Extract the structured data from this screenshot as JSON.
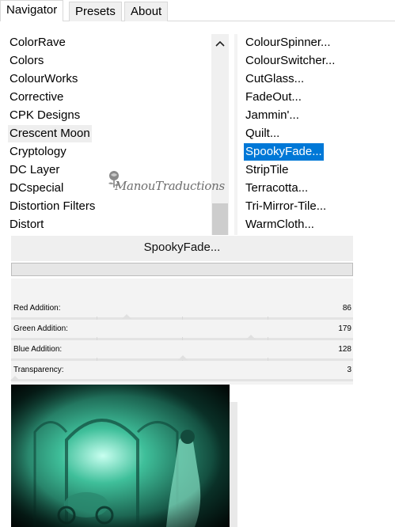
{
  "tabs": [
    {
      "label": "Navigator",
      "active": true
    },
    {
      "label": "Presets",
      "active": false
    },
    {
      "label": "About",
      "active": false
    }
  ],
  "categories": {
    "items": [
      "ColorRave",
      "Colors",
      "ColourWorks",
      "Corrective",
      "CPK Designs",
      "Crescent Moon",
      "Cryptology",
      "DC Layer",
      "DCspecial",
      "Distortion Filters",
      "Distort"
    ],
    "highlighted": "Crescent Moon"
  },
  "filters": {
    "items": [
      "ColourSpinner...",
      "ColourSwitcher...",
      "CutGlass...",
      "FadeOut...",
      "Jammin'...",
      "Quilt...",
      "SpookyFade...",
      "StripTile",
      "Terracotta...",
      "Tri-Mirror-Tile...",
      "WarmCloth..."
    ],
    "selected": "SpookyFade..."
  },
  "filter_title": "SpookyFade...",
  "sliders": [
    {
      "label": "Red Addition:",
      "value": "86",
      "level": 86
    },
    {
      "label": "Green Addition:",
      "value": "179",
      "level": 179
    },
    {
      "label": "Blue Addition:",
      "value": "128",
      "level": 128
    },
    {
      "label": "Transparency:",
      "value": "3",
      "level": 3
    }
  ],
  "slider_max": 255,
  "watermark": "ManouTraductions",
  "colors": {
    "selection": "#0078d7",
    "preview_glow": "#c8fff0",
    "preview_mid": "#3fbf9a",
    "preview_dark": "#0c3b30"
  },
  "icons": {
    "scroll_up": "chevron-up-icon",
    "watermark_logo": "rose-icon"
  }
}
